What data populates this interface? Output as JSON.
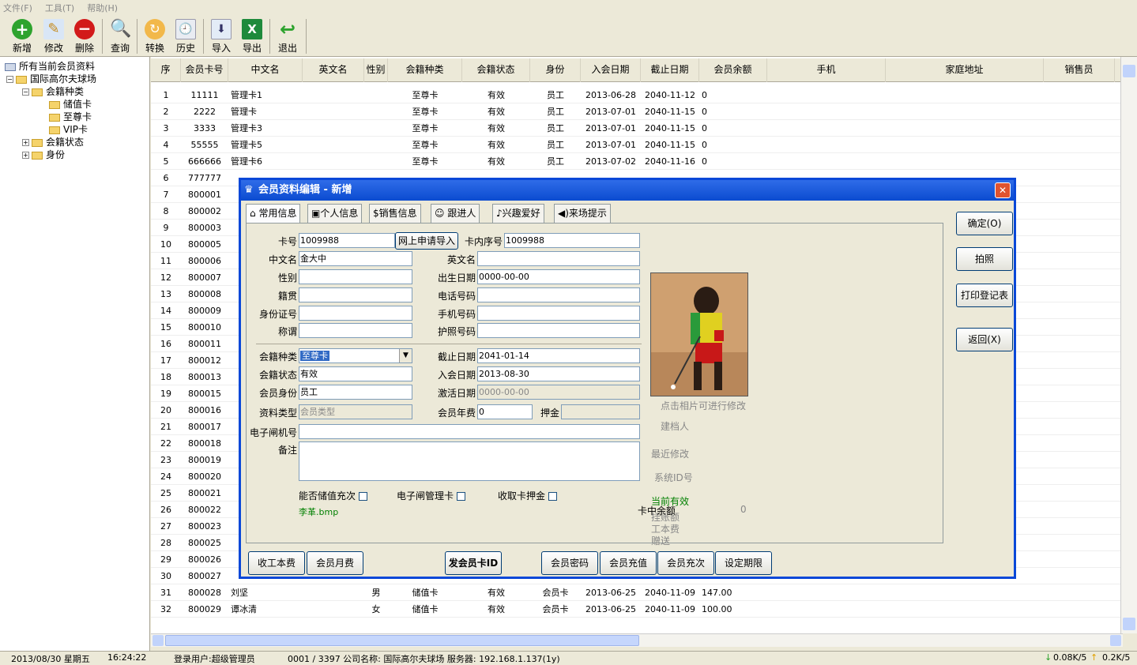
{
  "menu": [
    "文件(F)",
    "工具(T)",
    "帮助(H)"
  ],
  "toolbar": {
    "add": "新增",
    "edit": "修改",
    "delete": "删除",
    "query": "查询",
    "convert": "转换",
    "history": "历史",
    "import": "导入",
    "export": "导出",
    "exit": "退出"
  },
  "tree": {
    "root": "所有当前会员资料",
    "club": "国际高尔夫球场",
    "type": "会籍种类",
    "t1": "储值卡",
    "t2": "至尊卡",
    "t3": "VIP卡",
    "status": "会籍状态",
    "identity": "身份"
  },
  "grid": {
    "headers": [
      "序",
      "会员卡号",
      "中文名",
      "英文名",
      "性别",
      "会籍种类",
      "会籍状态",
      "身份",
      "入会日期",
      "截止日期",
      "会员余额",
      "手机",
      "家庭地址",
      "销售员"
    ],
    "rows": [
      [
        "1",
        "11111",
        "管理卡1",
        "",
        "",
        "至尊卡",
        "有效",
        "员工",
        "2013-06-28",
        "2040-11-12",
        "0"
      ],
      [
        "2",
        "2222",
        "管理卡",
        "",
        "",
        "至尊卡",
        "有效",
        "员工",
        "2013-07-01",
        "2040-11-15",
        "0"
      ],
      [
        "3",
        "3333",
        "管理卡3",
        "",
        "",
        "至尊卡",
        "有效",
        "员工",
        "2013-07-01",
        "2040-11-15",
        "0"
      ],
      [
        "4",
        "55555",
        "管理卡5",
        "",
        "",
        "至尊卡",
        "有效",
        "员工",
        "2013-07-01",
        "2040-11-15",
        "0"
      ],
      [
        "5",
        "666666",
        "管理卡6",
        "",
        "",
        "至尊卡",
        "有效",
        "员工",
        "2013-07-02",
        "2040-11-16",
        "0"
      ],
      [
        "6",
        "777777",
        "",
        "",
        "",
        "",
        "",
        "",
        "",
        "",
        ""
      ],
      [
        "7",
        "800001",
        "",
        "",
        "",
        "",
        "",
        "",
        "",
        "",
        ""
      ],
      [
        "8",
        "800002",
        "",
        "",
        "",
        "",
        "",
        "",
        "",
        "",
        ""
      ],
      [
        "9",
        "800003",
        "",
        "",
        "",
        "",
        "",
        "",
        "",
        "",
        ""
      ],
      [
        "10",
        "800005",
        "",
        "",
        "",
        "",
        "",
        "",
        "",
        "",
        ""
      ],
      [
        "11",
        "800006",
        "",
        "",
        "",
        "",
        "",
        "",
        "",
        "",
        ""
      ],
      [
        "12",
        "800007",
        "",
        "",
        "",
        "",
        "",
        "",
        "",
        "",
        ""
      ],
      [
        "13",
        "800008",
        "",
        "",
        "",
        "",
        "",
        "",
        "",
        "",
        ""
      ],
      [
        "14",
        "800009",
        "",
        "",
        "",
        "",
        "",
        "",
        "",
        "",
        ""
      ],
      [
        "15",
        "800010",
        "",
        "",
        "",
        "",
        "",
        "",
        "",
        "",
        ""
      ],
      [
        "16",
        "800011",
        "",
        "",
        "",
        "",
        "",
        "",
        "",
        "",
        ""
      ],
      [
        "17",
        "800012",
        "",
        "",
        "",
        "",
        "",
        "",
        "",
        "",
        ""
      ],
      [
        "18",
        "800013",
        "",
        "",
        "",
        "",
        "",
        "",
        "",
        "",
        ""
      ],
      [
        "19",
        "800015",
        "",
        "",
        "",
        "",
        "",
        "",
        "",
        "",
        ""
      ],
      [
        "20",
        "800016",
        "",
        "",
        "",
        "",
        "",
        "",
        "",
        "",
        ""
      ],
      [
        "21",
        "800017",
        "",
        "",
        "",
        "",
        "",
        "",
        "",
        "",
        ""
      ],
      [
        "22",
        "800018",
        "",
        "",
        "",
        "",
        "",
        "",
        "",
        "",
        ""
      ],
      [
        "23",
        "800019",
        "",
        "",
        "",
        "",
        "",
        "",
        "",
        "",
        ""
      ],
      [
        "24",
        "800020",
        "",
        "",
        "",
        "",
        "",
        "",
        "",
        "",
        ""
      ],
      [
        "25",
        "800021",
        "",
        "",
        "",
        "",
        "",
        "",
        "",
        "",
        ""
      ],
      [
        "26",
        "800022",
        "",
        "",
        "",
        "",
        "",
        "",
        "",
        "",
        ""
      ],
      [
        "27",
        "800023",
        "",
        "",
        "",
        "",
        "",
        "",
        "",
        "",
        ""
      ],
      [
        "28",
        "800025",
        "",
        "",
        "",
        "",
        "",
        "",
        "",
        "",
        ""
      ],
      [
        "29",
        "800026",
        "",
        "",
        "",
        "",
        "",
        "",
        "",
        "",
        ""
      ],
      [
        "30",
        "800027",
        "",
        "",
        "",
        "",
        "",
        "",
        "",
        "",
        ""
      ],
      [
        "31",
        "800028",
        "刘坚",
        "",
        "男",
        "储值卡",
        "有效",
        "会员卡",
        "2013-06-25",
        "2040-11-09",
        "147.00"
      ],
      [
        "32",
        "800029",
        "谭冰清",
        "",
        "女",
        "储值卡",
        "有效",
        "会员卡",
        "2013-06-25",
        "2040-11-09",
        "100.00"
      ]
    ]
  },
  "status": {
    "date": "2013/08/30 星期五",
    "time": "16:24:22",
    "user": "登录用户:超级管理员",
    "info": "0001 / 3397 公司名称: 国际高尔夫球场 服务器: 192.168.1.137(1y)",
    "down": "0.08K/5",
    "up": "0.2K/5"
  },
  "dialog": {
    "title": "会员资料编辑 - 新增",
    "tabs": [
      "常用信息",
      "个人信息",
      "销售信息",
      "跟进人",
      "兴趣爱好",
      "来场提示"
    ],
    "labels": {
      "card_no": "卡号",
      "inner_no": "卡内序号",
      "cn_name": "中文名",
      "en_name": "英文名",
      "gender": "性别",
      "birth": "出生日期",
      "native": "籍贯",
      "phone": "电话号码",
      "id_no": "身份证号",
      "mobile": "手机号码",
      "title": "称谓",
      "passport": "护照号码",
      "member_type": "会籍种类",
      "expire": "截止日期",
      "member_status": "会籍状态",
      "join_date": "入会日期",
      "member_identity": "会员身份",
      "activate": "激活日期",
      "data_type": "资料类型",
      "annual_fee": "会员年费",
      "deposit": "押金",
      "gate_no": "电子闸机号",
      "remark": "备注",
      "can_recharge": "能否储值充次",
      "gate_card": "电子闸管理卡",
      "collect_deposit": "收取卡押金"
    },
    "values": {
      "card_no": "1009988",
      "inner_no": "1009988",
      "cn_name": "金大中",
      "birth": "0000-00-00",
      "member_type": "至尊卡",
      "expire": "2041-01-14",
      "member_status": "有效",
      "join_date": "2013-08-30",
      "member_identity": "员工",
      "activate": "0000-00-00",
      "data_type": "会员类型",
      "annual_fee": "0"
    },
    "apply_btn": "网上申请导入",
    "photo_hint": "点击相片可进行修改",
    "file": "李革.bmp",
    "info": {
      "creator": "建档人",
      "last_mod": "最近修改",
      "sys_id": "系统ID号",
      "valid": "当前有效",
      "hang": "挂账额",
      "cost": "工本费",
      "gift": "赠送",
      "card_balance": "卡中余额",
      "card_balance_value": "0"
    },
    "side_buttons": [
      "确定(O)",
      "拍照",
      "打印登记表",
      "返回(X)"
    ],
    "bottom_buttons": [
      "收工本费",
      "会员月费",
      "发会员卡ID",
      "会员密码",
      "会员充值",
      "会员充次",
      "设定期限"
    ]
  }
}
